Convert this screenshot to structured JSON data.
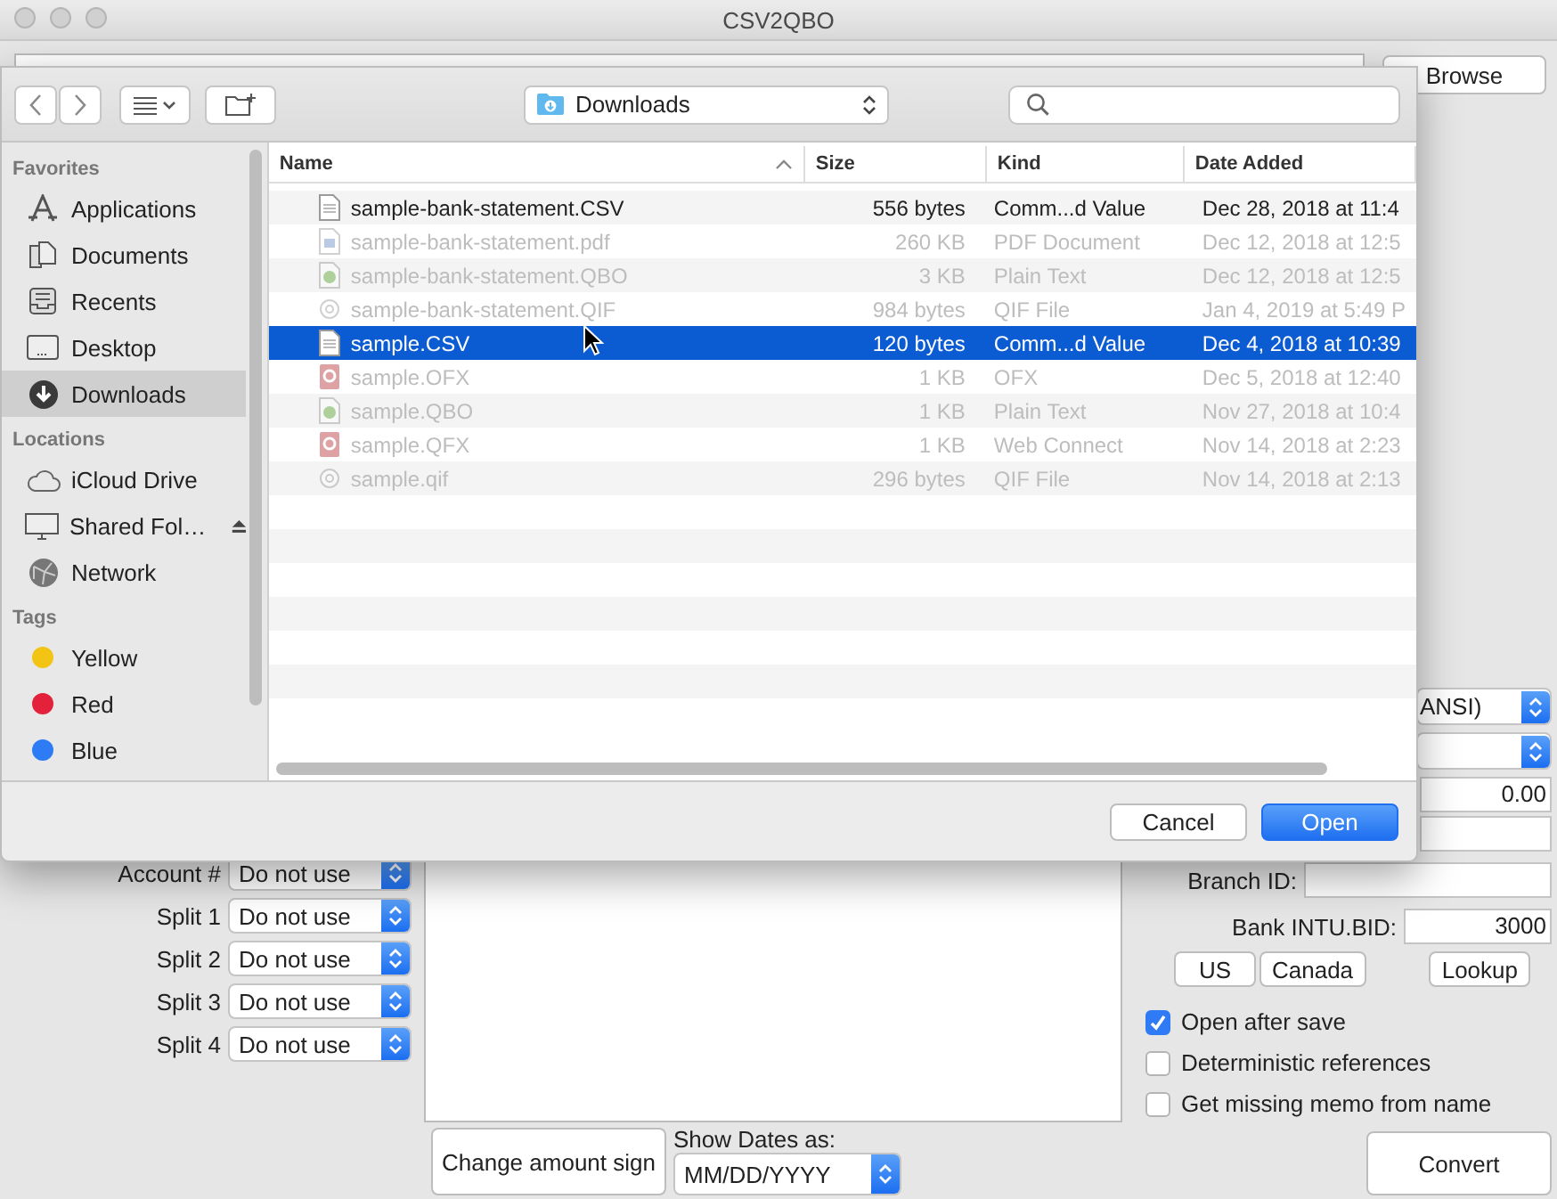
{
  "window": {
    "title": "CSV2QBO"
  },
  "browse_button": "Browse",
  "dialog": {
    "location": "Downloads",
    "sidebar": [
      {
        "heading": "Favorites",
        "items": [
          {
            "label": "Applications",
            "kind": "applications",
            "selected": false
          },
          {
            "label": "Documents",
            "kind": "documents",
            "selected": false
          },
          {
            "label": "Recents",
            "kind": "recents",
            "selected": false
          },
          {
            "label": "Desktop",
            "kind": "desktop",
            "selected": false
          },
          {
            "label": "Downloads",
            "kind": "downloads",
            "selected": true
          }
        ]
      },
      {
        "heading": "Locations",
        "items": [
          {
            "label": "iCloud Drive",
            "kind": "cloud",
            "selected": false,
            "eject": false
          },
          {
            "label": "Shared Fol…",
            "kind": "display",
            "selected": false,
            "eject": true
          },
          {
            "label": "Network",
            "kind": "network",
            "selected": false,
            "eject": false
          }
        ]
      },
      {
        "heading": "Tags",
        "items": [
          {
            "label": "Yellow",
            "kind": "tag",
            "color": "#f2c414",
            "selected": false
          },
          {
            "label": "Red",
            "kind": "tag",
            "color": "#e3213b",
            "selected": false
          },
          {
            "label": "Blue",
            "kind": "tag",
            "color": "#2d7cf6",
            "selected": false
          }
        ]
      }
    ],
    "columns": [
      {
        "label": "Name",
        "sorted": true
      },
      {
        "label": "Size",
        "sorted": false
      },
      {
        "label": "Kind",
        "sorted": false
      },
      {
        "label": "Date Added",
        "sorted": false
      }
    ],
    "files": [
      {
        "kind": "document",
        "name": "sample-bank-statement.CSV",
        "size": "556 bytes",
        "file_kind": "Comm...d Value",
        "date_added": "Dec 28, 2018 at 11:4",
        "enabled": true,
        "selected": false
      },
      {
        "kind": "pdf",
        "name": "sample-bank-statement.pdf",
        "size": "260 KB",
        "file_kind": "PDF Document",
        "date_added": "Dec 12, 2018 at 12:5",
        "enabled": false,
        "selected": false
      },
      {
        "kind": "qbo",
        "name": "sample-bank-statement.QBO",
        "size": "3 KB",
        "file_kind": "Plain Text",
        "date_added": "Dec 12, 2018 at 12:5",
        "enabled": false,
        "selected": false
      },
      {
        "kind": "qif",
        "name": "sample-bank-statement.QIF",
        "size": "984 bytes",
        "file_kind": "QIF File",
        "date_added": "Jan 4, 2019 at 5:49 P",
        "enabled": false,
        "selected": false
      },
      {
        "kind": "document",
        "name": "sample.CSV",
        "size": "120 bytes",
        "file_kind": "Comm...d Value",
        "date_added": "Dec 4, 2018 at 10:39",
        "enabled": true,
        "selected": true
      },
      {
        "kind": "quicken",
        "name": "sample.OFX",
        "size": "1 KB",
        "file_kind": "OFX",
        "date_added": "Dec 5, 2018 at 12:40",
        "enabled": false,
        "selected": false
      },
      {
        "kind": "qbo",
        "name": "sample.QBO",
        "size": "1 KB",
        "file_kind": "Plain Text",
        "date_added": "Nov 27, 2018 at 10:4",
        "enabled": false,
        "selected": false
      },
      {
        "kind": "quicken",
        "name": "sample.QFX",
        "size": "1 KB",
        "file_kind": "Web Connect",
        "date_added": "Nov 14, 2018 at 2:23",
        "enabled": false,
        "selected": false
      },
      {
        "kind": "qif",
        "name": "sample.qif",
        "size": "296 bytes",
        "file_kind": "QIF File",
        "date_added": "Nov 14, 2018 at 2:13",
        "enabled": false,
        "selected": false
      }
    ],
    "buttons": [
      {
        "label": "Cancel",
        "default": false
      },
      {
        "label": "Open",
        "default": true
      }
    ]
  },
  "mapping": [
    {
      "label": "Account #",
      "value": "Do not use"
    },
    {
      "label": "Split 1",
      "value": "Do not use"
    },
    {
      "label": "Split 2",
      "value": "Do not use"
    },
    {
      "label": "Split 3",
      "value": "Do not use"
    },
    {
      "label": "Split 4",
      "value": "Do not use"
    }
  ],
  "encoding": "ANSI)",
  "amount_field": "0.00",
  "branch_id": {
    "label": "Branch ID:"
  },
  "bank_intu_bid": {
    "label": "Bank INTU.BID:",
    "value": "3000"
  },
  "country_buttons": [
    "US",
    "Canada"
  ],
  "lookup_button": "Lookup",
  "options": [
    {
      "label": "Open after save",
      "checked": true
    },
    {
      "label": "Deterministic references",
      "checked": false
    },
    {
      "label": "Get missing memo from name",
      "checked": false
    }
  ],
  "change_sign_button": "Change amount sign",
  "date_format": {
    "label": "Show Dates as:",
    "value": "MM/DD/YYYY"
  },
  "convert_button": "Convert"
}
